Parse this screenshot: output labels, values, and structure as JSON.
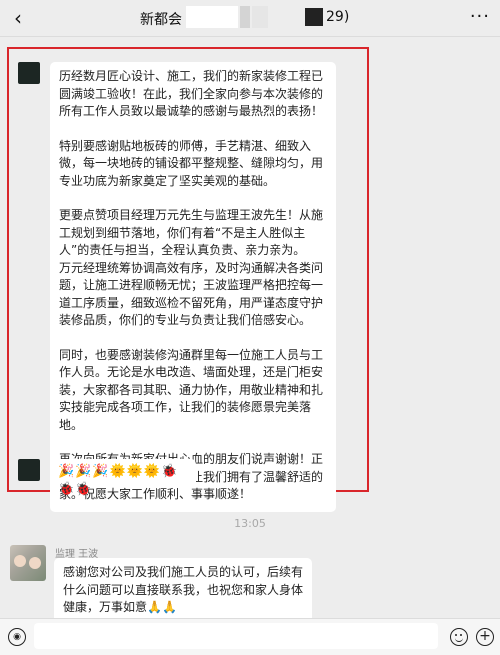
{
  "header": {
    "back_icon": "chevron-left-icon",
    "title": "新都会",
    "member_count": "29)",
    "more_icon": "more-icon"
  },
  "messages": [
    {
      "id": "main",
      "paragraphs": [
        "历经数月匠心设计、施工，我们的新家装修工程已圆满竣工验收！在此，我们全家向参与本次装修的所有工作人员致以最诚挚的感谢与最热烈的表扬！",
        "特别要感谢贴地板砖的师傅，手艺精湛、细致入微，每一块地砖的铺设都平整规整、缝隙均匀，用专业功底为新家奠定了坚实美观的基础。",
        "更要点赞项目经理万元先生与监理王波先生！从施工规划到细节落地，你们有着“不是主人胜似主人”的责任与担当，全程认真负责、亲力亲为。\n万元经理统筹协调高效有序，及时沟通解决各类问题，让施工进程顺畅无忧；王波监理严格把控每一道工序质量，细致巡检不留死角，用严谨态度守护装修品质，你们的专业与负责让我们倍感安心。",
        "同时，也要感谢装修沟通群里每一位施工人员与工作人员。无论是水电改造、墙面处理，还是门柜安装，大家都各司其职、通力协作，用敬业精神和扎实技能完成各项工作，让我们的装修愿景完美落地。",
        "再次向所有为新家付出心血的朋友们说声谢谢！正是你们的责任与付出，才让我们拥有了温馨舒适的家。祝愿大家工作顺利、事事顺遂！"
      ]
    },
    {
      "id": "emoji",
      "text": "🎉🎉🎉🌞🌞🌞🐞🐞🐞"
    }
  ],
  "timestamp": "13:05",
  "reply": {
    "sender": "监理 王波",
    "text": "感谢您对公司及我们施工人员的认可，后续有什么问题可以直接联系我，也祝您和家人身体健康，万事如意🙏🙏"
  },
  "inputbar": {
    "voice_icon": "voice-icon",
    "emoji_icon": "emoji-icon",
    "plus_icon": "plus-icon"
  },
  "colors": {
    "highlight_border": "#d9262b",
    "background": "#ededed",
    "bubble": "#ffffff"
  }
}
